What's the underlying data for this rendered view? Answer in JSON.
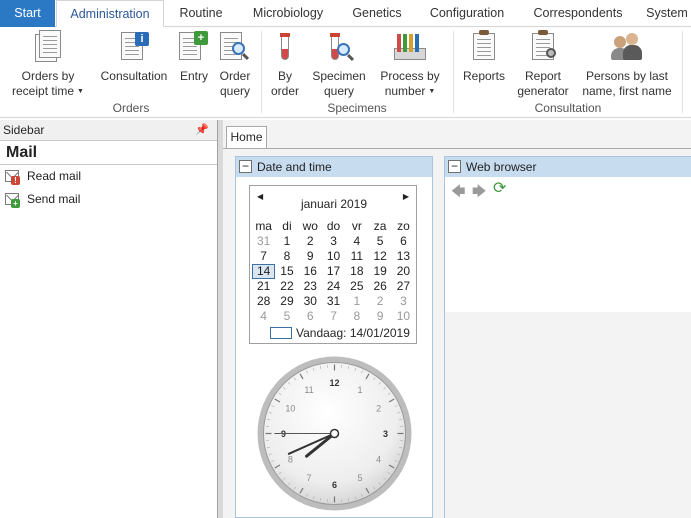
{
  "ribbon_tabs": [
    "Start",
    "Administration",
    "Routine",
    "Microbiology",
    "Genetics",
    "Configuration",
    "Correspondents",
    "System"
  ],
  "active_tab": "Administration",
  "ribbon": {
    "orders": {
      "group_label": "Orders",
      "buttons": [
        {
          "line1": "Orders by",
          "line2": "receipt time",
          "dropdown": true
        },
        {
          "line1": "Consultation",
          "line2": ""
        },
        {
          "line1": "Entry",
          "line2": ""
        },
        {
          "line1": "Order",
          "line2": "query"
        }
      ]
    },
    "specimens": {
      "group_label": "Specimens",
      "buttons": [
        {
          "line1": "By",
          "line2": "order"
        },
        {
          "line1": "Specimen",
          "line2": "query"
        },
        {
          "line1": "Process by",
          "line2": "number",
          "dropdown": true
        }
      ]
    },
    "consultation": {
      "group_label": "Consultation",
      "buttons": [
        {
          "line1": "Reports",
          "line2": ""
        },
        {
          "line1": "Report",
          "line2": "generator"
        },
        {
          "line1": "Persons by last",
          "line2": "name, first name"
        }
      ]
    }
  },
  "sidebar": {
    "header": "Sidebar",
    "title": "Mail",
    "items": [
      {
        "label": "Read mail",
        "icon": "read-mail-icon"
      },
      {
        "label": "Send mail",
        "icon": "send-mail-icon"
      }
    ]
  },
  "document_tab": "Home",
  "date_panel": {
    "title": "Date and time",
    "calendar": {
      "month_label": "januari 2019",
      "weekdays": [
        "ma",
        "di",
        "wo",
        "do",
        "vr",
        "za",
        "zo"
      ],
      "weeks": [
        [
          "31",
          "1",
          "2",
          "3",
          "4",
          "5",
          "6"
        ],
        [
          "7",
          "8",
          "9",
          "10",
          "11",
          "12",
          "13"
        ],
        [
          "14",
          "15",
          "16",
          "17",
          "18",
          "19",
          "20"
        ],
        [
          "21",
          "22",
          "23",
          "24",
          "25",
          "26",
          "27"
        ],
        [
          "28",
          "29",
          "30",
          "31",
          "1",
          "2",
          "3"
        ],
        [
          "4",
          "5",
          "6",
          "7",
          "8",
          "9",
          "10"
        ]
      ],
      "selected_day": "14",
      "today_label": "Vandaag: 14/01/2019"
    },
    "clock": {
      "numerals": [
        "12",
        "1",
        "2",
        "3",
        "4",
        "5",
        "6",
        "7",
        "8",
        "9",
        "10",
        "11"
      ],
      "hour": 7.7,
      "minute": 41,
      "second": 45
    }
  },
  "browser_panel": {
    "title": "Web browser"
  },
  "colors": {
    "start_tab": "#2b78c5",
    "panel_header": "#c8dcf0",
    "accent": "#2b5797"
  }
}
